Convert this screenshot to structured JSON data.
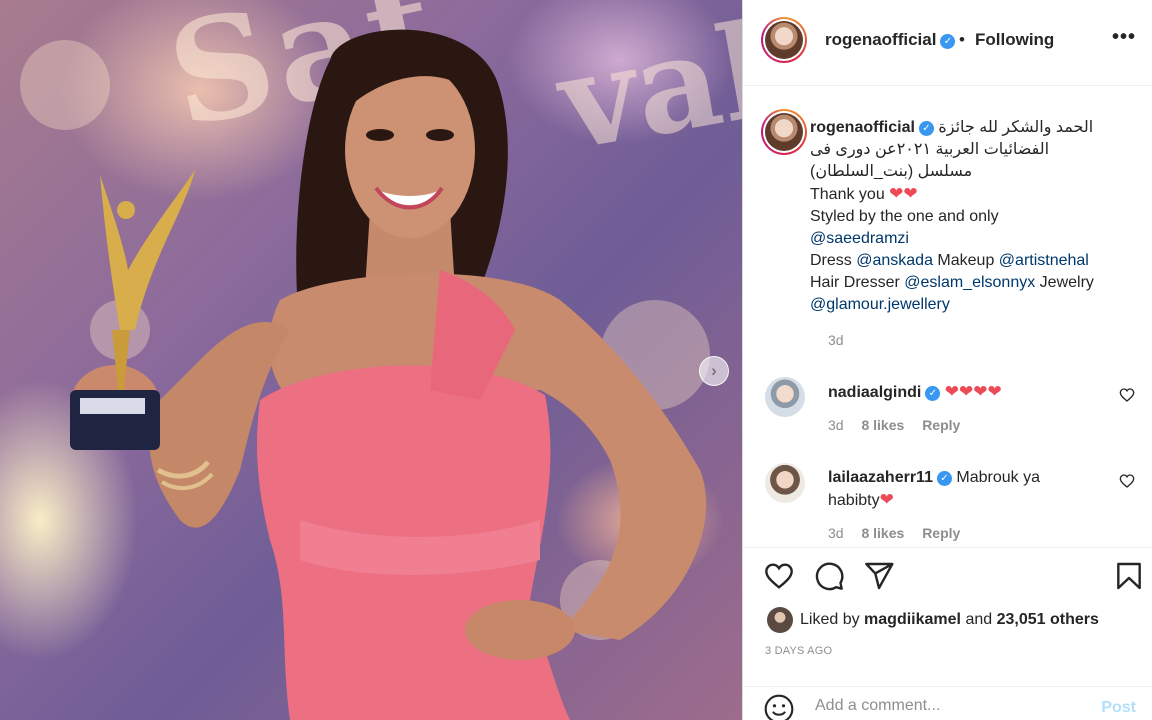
{
  "post": {
    "username": "rogenaofficial",
    "follow_status": "Following",
    "more_label": "•••",
    "separator": "•"
  },
  "caption": {
    "username": "rogenaofficial",
    "lines_rtl": [
      "الحمد والشكر لله جائزة",
      "الفضائيات العربية ٢٠٢١عن دورى فى",
      "مسلسل (بنت_السلطان)"
    ],
    "thanks": "Thank you",
    "hearts": "❤❤",
    "styled_by": "Styled by the one and only",
    "mention_stylist": "@saeedramzi",
    "dress_label": "Dress",
    "mention_dress": "@anskada",
    "makeup_label": "Makeup",
    "mention_makeup": "@artistnehal",
    "hair_label": "Hair Dresser",
    "mention_hair": "@eslam_elsonnyx",
    "jewelry_label": "Jewelry",
    "mention_jewelry": "@glamour.jewellery",
    "time": "3d"
  },
  "comments": [
    {
      "username": "nadiaalgindi",
      "text": "",
      "hearts": "❤❤❤❤",
      "time": "3d",
      "likes": "8 likes",
      "reply": "Reply"
    },
    {
      "username": "lailaazaherr11",
      "text": "Mabrouk ya habibty",
      "hearts": "❤",
      "time": "3d",
      "likes": "8 likes",
      "reply": "Reply"
    }
  ],
  "likes": {
    "prefix": "Liked by",
    "user": "magdiikamel",
    "joiner": "and",
    "others": "23,051 others"
  },
  "posted_ago": "3 DAYS AGO",
  "add_comment": {
    "placeholder": "Add a comment...",
    "post_label": "Post"
  },
  "photo": {
    "next_label": "›",
    "sign_text_1": "Sat",
    "sign_text_2": "val"
  }
}
